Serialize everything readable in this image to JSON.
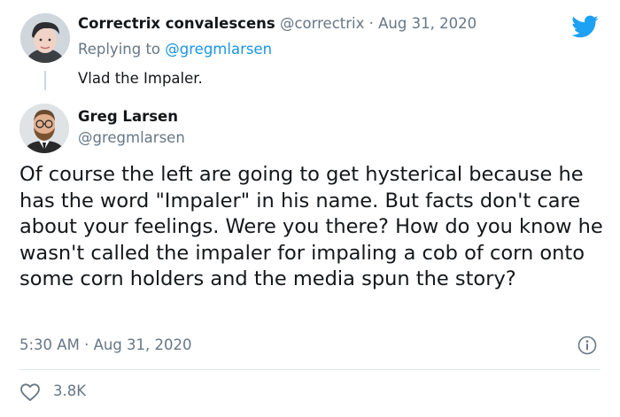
{
  "reply": {
    "display_name": "Correctrix convalescens",
    "handle": "@correctrix",
    "separator": "·",
    "date": "Aug 31, 2020",
    "replying_prefix": "Replying to",
    "replying_to": "@gregmlarsen",
    "text": "Vlad the Impaler."
  },
  "main": {
    "display_name": "Greg Larsen",
    "handle": "@gregmlarsen",
    "text": "Of course the left are going to get hysterical because he has the word \"Impaler\" in his name. But facts don't care about your feelings. Were you there? How do you know he wasn't called the impaler for impaling a cob of corn onto some corn holders and the media spun the story?",
    "time": "5:30 AM",
    "separator": "·",
    "date": "Aug 31, 2020",
    "likes": "3.8K"
  },
  "colors": {
    "twitter_blue": "#1da1f2",
    "link_blue": "#1b95e0",
    "muted": "#657786"
  },
  "icons": {
    "brand": "twitter-bird-icon",
    "info": "info-icon",
    "like": "heart-icon"
  }
}
